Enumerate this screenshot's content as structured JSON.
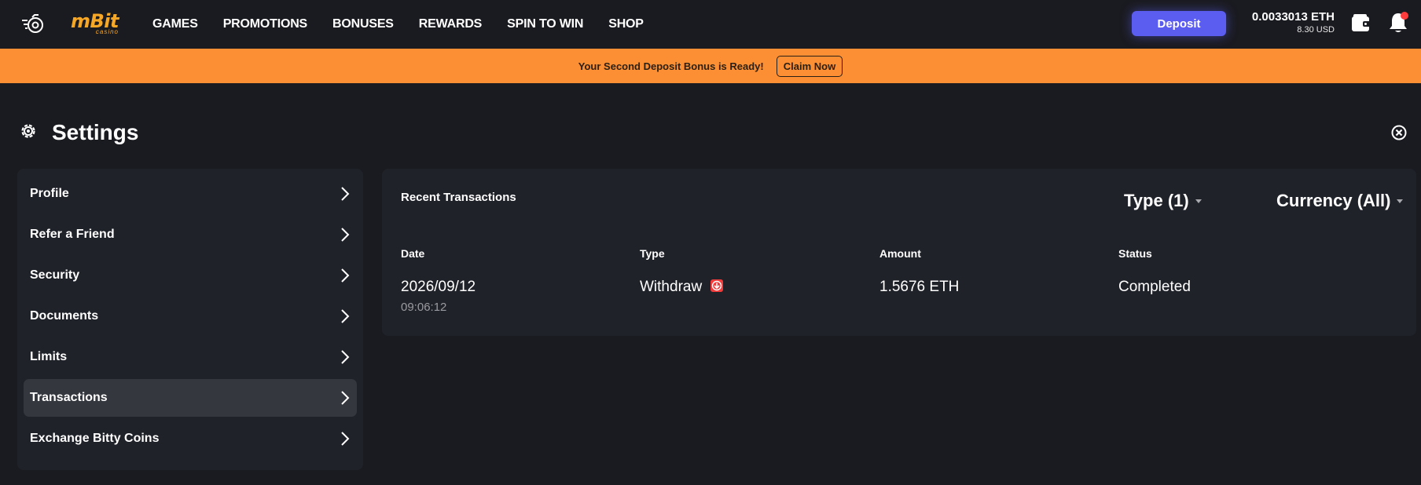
{
  "header": {
    "logo_text": "mBit",
    "logo_sub": "casino",
    "nav": [
      "GAMES",
      "PROMOTIONS",
      "BONUSES",
      "REWARDS",
      "SPIN TO WIN",
      "SHOP"
    ],
    "deposit_label": "Deposit",
    "balance_crypto": "0.0033013 ETH",
    "balance_fiat": "8.30 USD"
  },
  "promo": {
    "text": "Your Second Deposit Bonus is Ready!",
    "cta": "Claim Now"
  },
  "settings": {
    "title": "Settings"
  },
  "sidebar": {
    "items": [
      {
        "label": "Profile"
      },
      {
        "label": "Refer a Friend"
      },
      {
        "label": "Security"
      },
      {
        "label": "Documents"
      },
      {
        "label": "Limits"
      },
      {
        "label": "Transactions"
      },
      {
        "label": "Exchange Bitty Coins"
      }
    ],
    "active": "Transactions"
  },
  "transactions": {
    "title": "Recent Transactions",
    "filter_type": "Type (1)",
    "filter_currency": "Currency (All)",
    "columns": [
      "Date",
      "Type",
      "Amount",
      "Status"
    ],
    "rows": [
      {
        "date": "2026/09/12",
        "time": "09:06:12",
        "type": "Withdraw",
        "amount": "1.5676 ETH",
        "status": "Completed"
      }
    ]
  },
  "colors": {
    "background": "#1a1b20",
    "panel": "#20222a",
    "accent": "#5b5cf0",
    "promo": "#fc8f33",
    "logo": "#f7a726",
    "withdraw": "#f23c3c"
  }
}
